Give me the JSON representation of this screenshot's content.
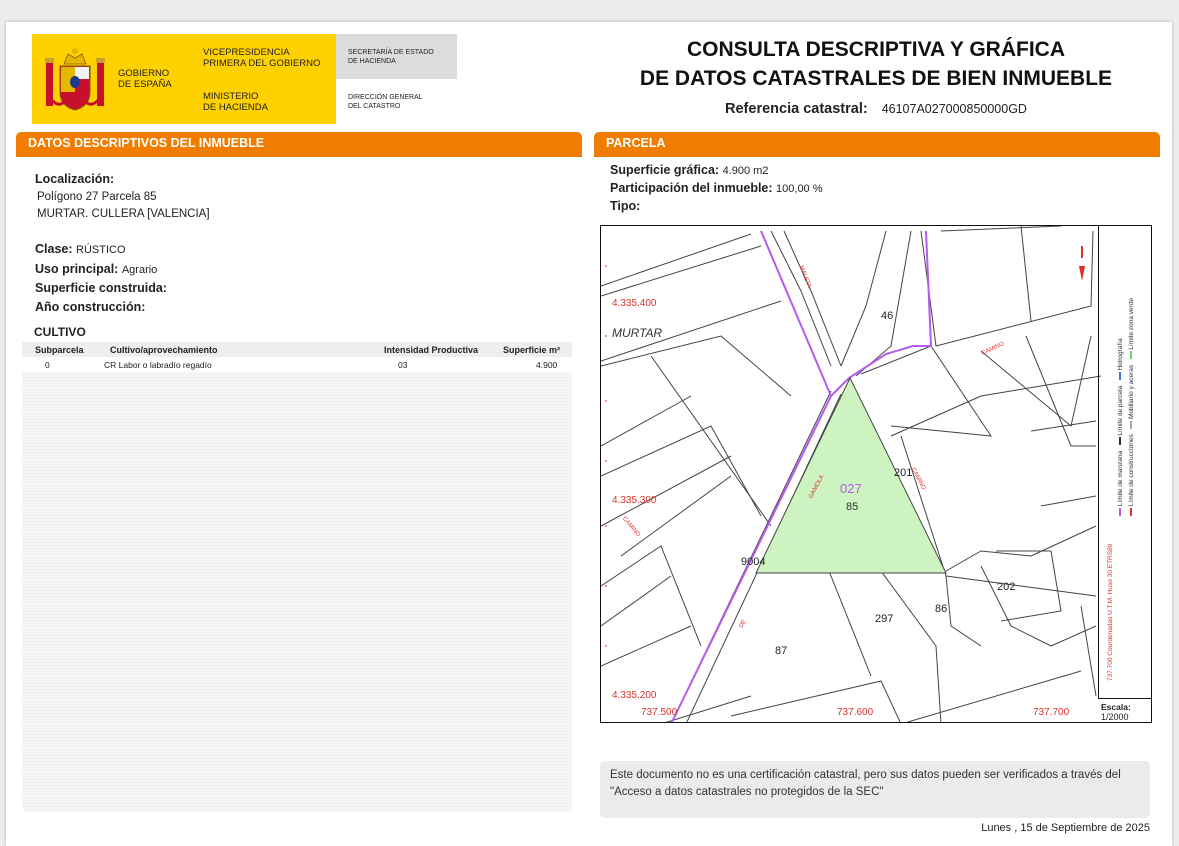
{
  "header": {
    "gobierno": [
      "GOBIERNO",
      "DE ESPAÑA"
    ],
    "vicepresidencia": [
      "VICEPRESIDENCIA",
      "PRIMERA DEL GOBIERNO"
    ],
    "ministerio": [
      "MINISTERIO",
      "DE HACIENDA"
    ],
    "secretaria": [
      "SECRETARÍA DE ESTADO",
      "DE HACIENDA"
    ],
    "direccion": [
      "DIRECCIÓN GENERAL",
      "DEL CATASTRO"
    ]
  },
  "title": {
    "line1": "CONSULTA DESCRIPTIVA Y GRÁFICA",
    "line2": "DE DATOS CATASTRALES DE BIEN INMUEBLE",
    "ref_label": "Referencia catastral:",
    "ref_value": "46107A027000850000GD"
  },
  "left": {
    "section_title": "DATOS DESCRIPTIVOS DEL INMUEBLE",
    "localizacion_label": "Localización:",
    "localizacion_line1": "Polígono 27 Parcela 85",
    "localizacion_line2": "MURTAR. CULLERA [VALENCIA]",
    "clase_label": "Clase:",
    "clase_value": "RÚSTICO",
    "uso_label": "Uso principal:",
    "uso_value": "Agrario",
    "superficie_label": "Superficie construida:",
    "anio_label": "Año construcción:",
    "cultivo_title": "CULTIVO",
    "table": {
      "headers": [
        "Subparcela",
        "Cultivo/aprovechamiento",
        "Intensidad Productiva",
        "Superficie m²"
      ],
      "rows": [
        [
          "0",
          "CR Labor o labradío regadío",
          "03",
          "4.900"
        ]
      ]
    }
  },
  "right": {
    "section_title": "PARCELA",
    "superficie_label": "Superficie gráfica:",
    "superficie_value": "4.900 m2",
    "participacion_label": "Participación del inmueble:",
    "participacion_value": "100,00 %",
    "tipo_label": "Tipo:"
  },
  "map": {
    "place": "MURTAR",
    "y_coords": [
      "4.335.400",
      "4.335.300",
      "4.335.200"
    ],
    "x_coords": [
      "737.500",
      "737.600",
      "737.700"
    ],
    "parcel_number": "027",
    "parcel_id": "85",
    "neighbor_labels": [
      "46",
      "201",
      "9004",
      "87",
      "297",
      "86",
      "202"
    ],
    "road_labels": [
      "MALETA",
      "CAMINO",
      "GAMOLA",
      "CAMINO",
      "CAMINO",
      "DE"
    ],
    "legend": {
      "limite_manzana": "Límite de manzana",
      "limite_construcciones": "Límite de construcciones",
      "limite_parcela": "Límite de parcela",
      "mobiliario": "Mobiliario y aceras",
      "hidrografia": "Hidrografía",
      "zona_verde": "Límite zona verde",
      "coords": "737.700 Coordenadas U.T.M. Huso 30 ETRS89",
      "escala_label": "Escala:",
      "escala_value": "1/2000"
    },
    "colors": {
      "parcel_fill": "#cdf3c0",
      "boundary": "#b55cf0",
      "road_label": "#e0302a"
    }
  },
  "footer": {
    "notice": "Este documento no es una certificación catastral, pero sus datos pueden ser verificados a través del \"Acceso a datos catastrales no protegidos de la SEC\"",
    "date": "Lunes , 15 de Septiembre de 2025"
  }
}
